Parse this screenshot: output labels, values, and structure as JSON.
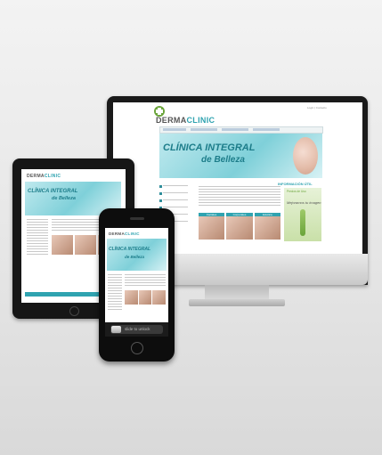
{
  "brand": {
    "prefix": "DERMA",
    "accent": "CLINIC",
    "accent_color": "#2fa3b0",
    "text_color": "#555555"
  },
  "hero": {
    "line1": "CLÍNICA INTEGRAL",
    "line2": "de Belleza"
  },
  "desktop": {
    "top_link": "Login | Contacto",
    "section_title": "INFORMACIÓN ÚTIL",
    "offer_label": "Precios de Uso",
    "offer_headline": "Mejoramos tu imagen",
    "thumb_headers": [
      "Faciales",
      "Corporales",
      "Estética"
    ]
  },
  "iphone": {
    "unlock_label": "slide to unlock"
  },
  "icons": [
    "logo-cross-icon",
    "menu-square-icon",
    "home-button-icon"
  ]
}
